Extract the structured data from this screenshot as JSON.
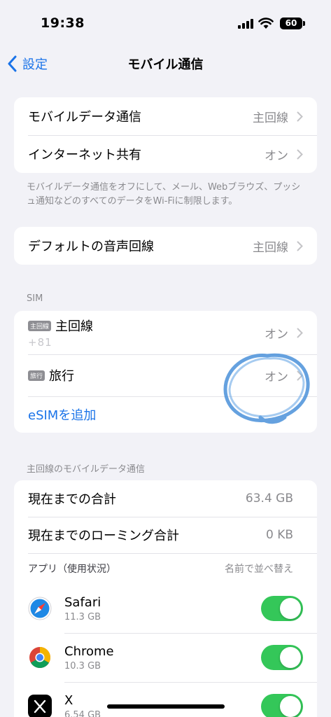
{
  "status": {
    "time": "19:38",
    "battery": "60"
  },
  "nav": {
    "back_label": "設定",
    "title": "モバイル通信"
  },
  "group1": {
    "rows": [
      {
        "label": "モバイルデータ通信",
        "value": "主回線"
      },
      {
        "label": "インターネット共有",
        "value": "オン"
      }
    ],
    "caption": "モバイルデータ通信をオフにして、メール、Webブラウズ、プッシュ通知などのすべてのデータをWi-Fiに制限します。"
  },
  "group2": {
    "label": "デフォルトの音声回線",
    "value": "主回線"
  },
  "sim": {
    "header": "SIM",
    "lines": [
      {
        "badge": "主回線",
        "name": "主回線",
        "number": "+81",
        "value": "オン"
      },
      {
        "badge": "旅行",
        "name": "旅行",
        "value": "オン"
      }
    ],
    "add_esim": "eSIMを追加"
  },
  "usage": {
    "header": "主回線のモバイルデータ通信",
    "rows": [
      {
        "label": "現在までの合計",
        "value": "63.4 GB"
      },
      {
        "label": "現在までのローミング合計",
        "value": "0 KB"
      }
    ],
    "apps_header": "アプリ（使用状況）",
    "sort_label": "名前で並べ替え",
    "apps": [
      {
        "name": "Safari",
        "size": "11.3 GB",
        "icon": "safari-icon",
        "enabled": true
      },
      {
        "name": "Chrome",
        "size": "10.3 GB",
        "icon": "chrome-icon",
        "enabled": true
      },
      {
        "name": "X",
        "size": "6.54 GB",
        "icon": "x-icon",
        "enabled": true
      }
    ]
  },
  "colors": {
    "accent": "#1a73e8",
    "toggle_on": "#34c759",
    "background": "#f2f2f7"
  }
}
